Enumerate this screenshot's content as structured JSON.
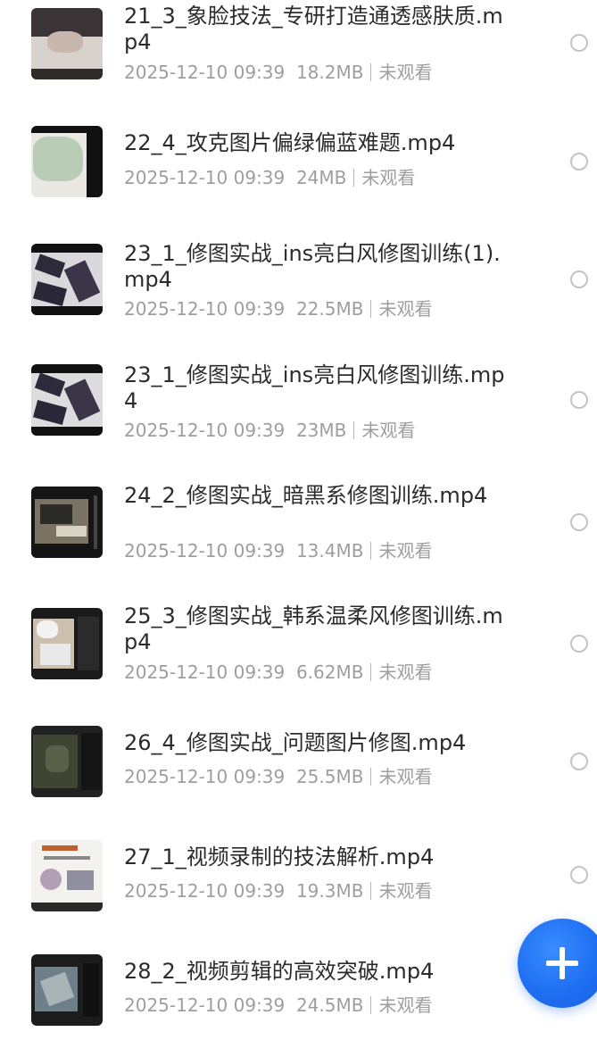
{
  "files": [
    {
      "name": "21_3_象脸技法_专研打造通透感肤质.mp4",
      "date": "2025-12-10 09:39",
      "size": "18.2MB",
      "status": "未观看"
    },
    {
      "name": "22_4_攻克图片偏绿偏蓝难题.mp4",
      "date": "2025-12-10 09:39",
      "size": "24MB",
      "status": "未观看"
    },
    {
      "name": "23_1_修图实战_ins亮白风修图训练(1).mp4",
      "date": "2025-12-10 09:39",
      "size": "22.5MB",
      "status": "未观看"
    },
    {
      "name": "23_1_修图实战_ins亮白风修图训练.mp4",
      "date": "2025-12-10 09:39",
      "size": "23MB",
      "status": "未观看"
    },
    {
      "name": "24_2_修图实战_暗黑系修图训练.mp4",
      "date": "2025-12-10 09:39",
      "size": "13.4MB",
      "status": "未观看"
    },
    {
      "name": "25_3_修图实战_韩系温柔风修图训练.mp4",
      "date": "2025-12-10 09:39",
      "size": "6.62MB",
      "status": "未观看"
    },
    {
      "name": "26_4_修图实战_问题图片修图.mp4",
      "date": "2025-12-10 09:39",
      "size": "25.5MB",
      "status": "未观看"
    },
    {
      "name": "27_1_视频录制的技法解析.mp4",
      "date": "2025-12-10 09:39",
      "size": "19.3MB",
      "status": "未观看"
    },
    {
      "name": "28_2_视频剪辑的高效突破.mp4",
      "date": "2025-12-10 09:39",
      "size": "24.5MB",
      "status": "未观看"
    }
  ],
  "fab": {
    "icon": "plus-icon",
    "color": "#1f6ff2"
  },
  "colors": {
    "title": "#2b2b2b",
    "meta": "#9e9e9e",
    "radio_border": "#c4c4c4"
  }
}
